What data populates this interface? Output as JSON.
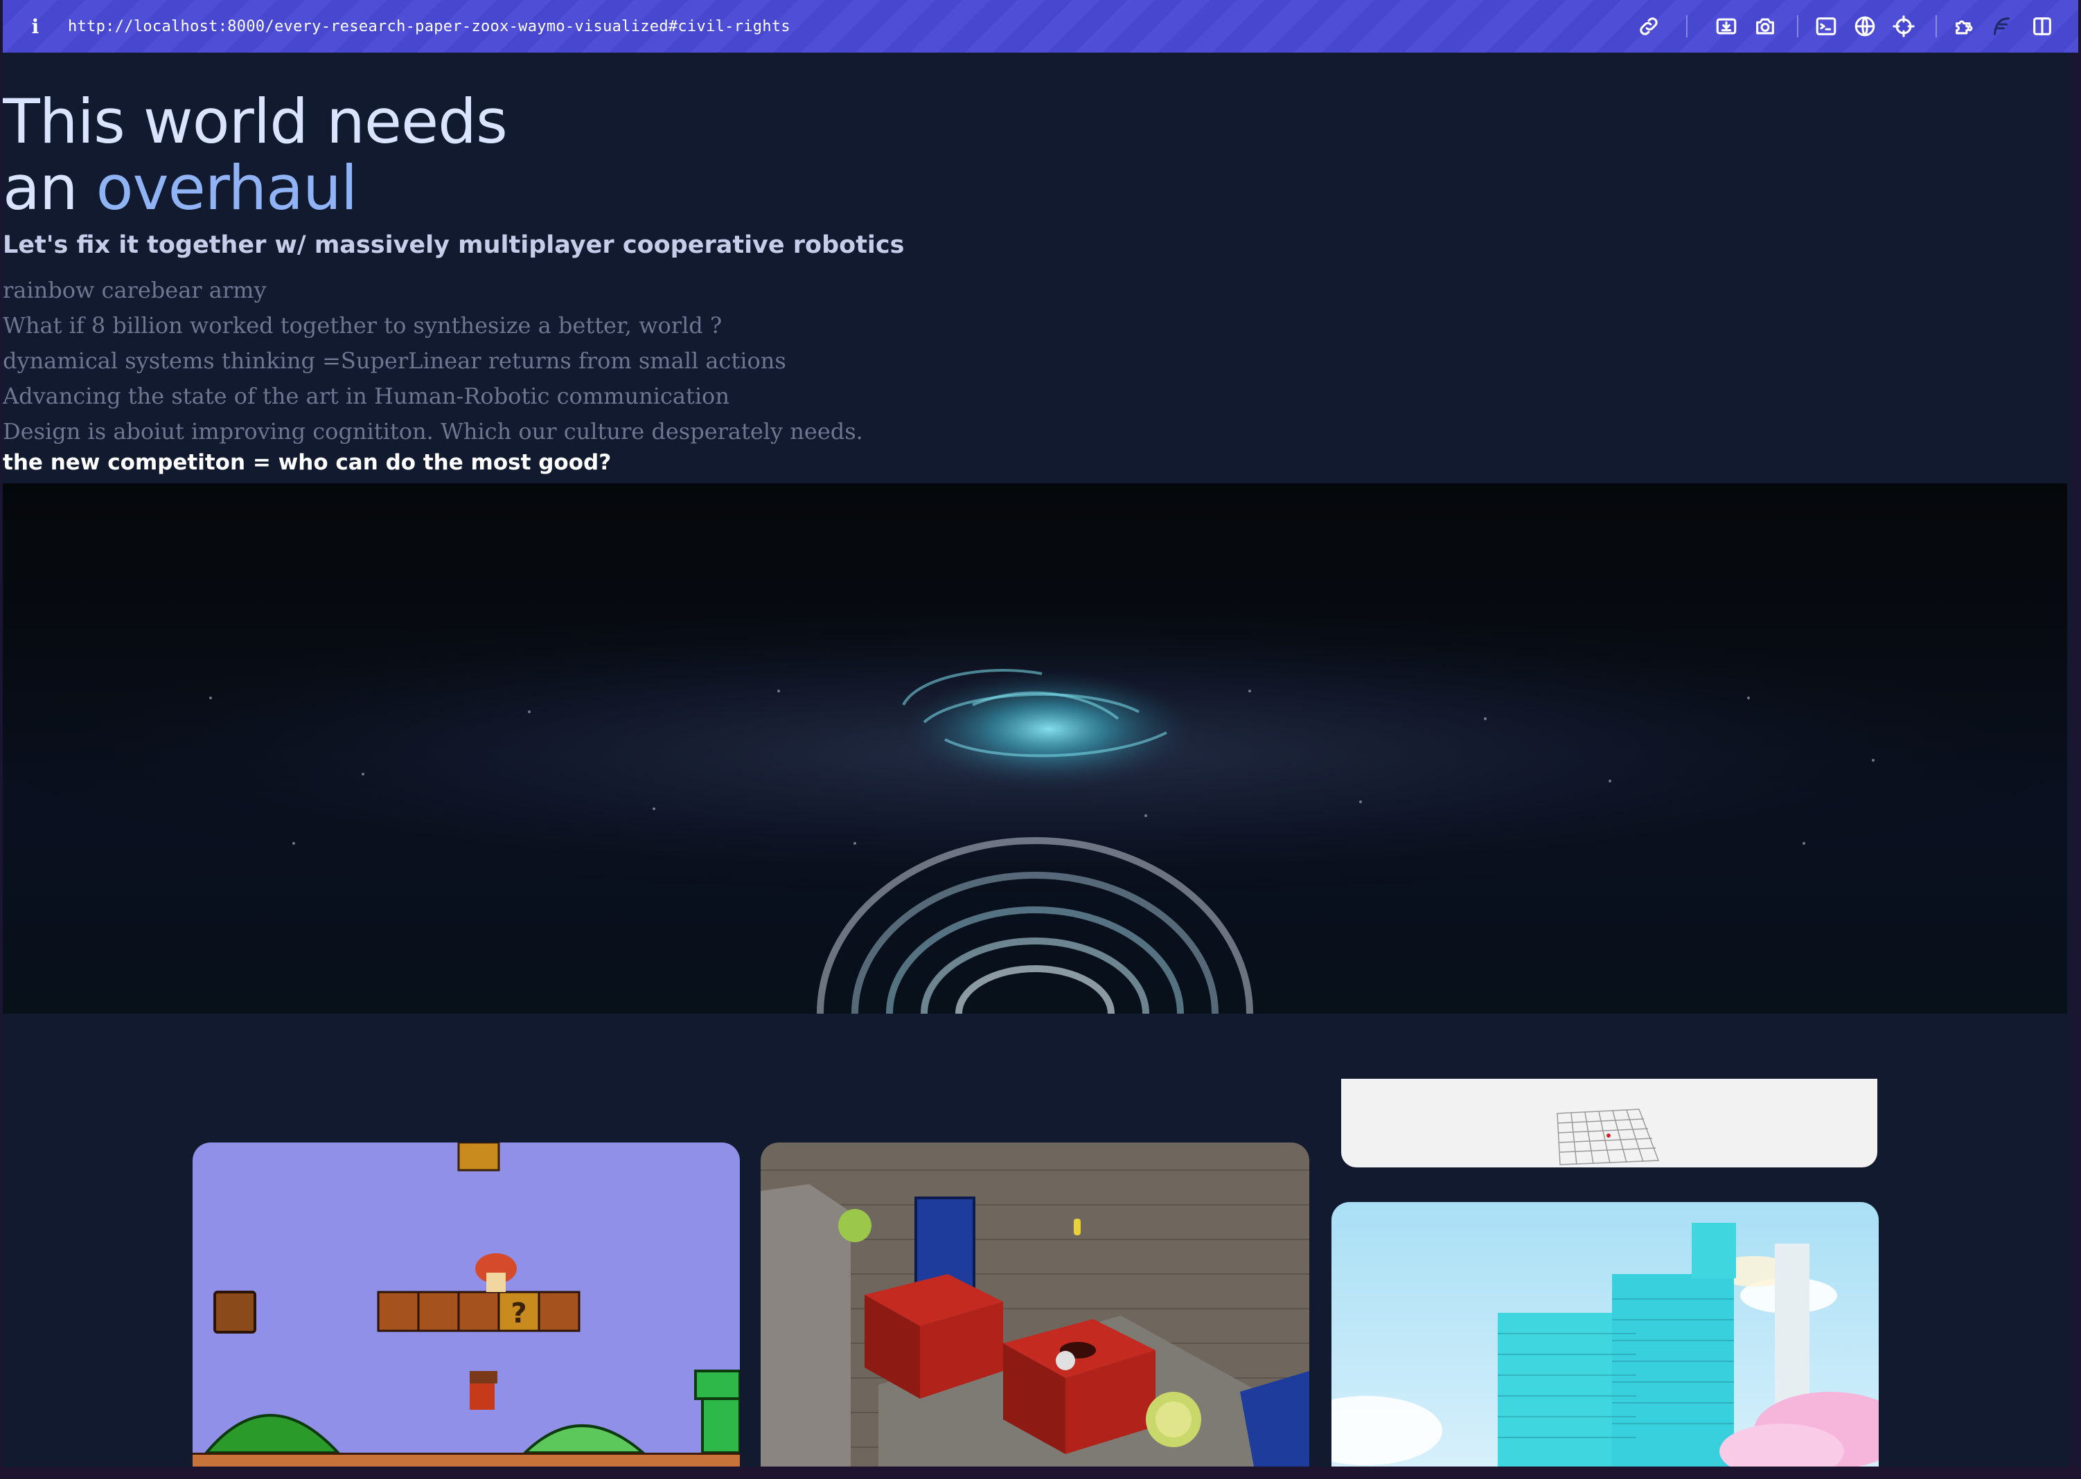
{
  "toolbar": {
    "url": "http://localhost:8000/every-research-paper-zoox-waymo-visualized#civil-rights",
    "info_icon": "i",
    "icons": [
      "link-icon",
      "download-icon",
      "camera-icon",
      "terminal-icon",
      "globe-icon",
      "crosshair-icon",
      "extensions-icon",
      "feather-icon",
      "sidebar-icon"
    ]
  },
  "hero": {
    "title_line1": "This world needs",
    "title_line2_prefix": "an ",
    "title_line2_highlight": "overhaul",
    "subtitle": "Let's fix it together w/ massively multiplayer cooperative robotics",
    "lines": [
      "rainbow carebear army",
      "What if 8 billion worked together to synthesize a better, world ?",
      "dynamical systems thinking =SuperLinear returns from small actions",
      "Advancing the state of the art in Human-Robotic communication",
      "Design is aboiut improving cognititon. Which our culture desperately needs."
    ],
    "tagline": "the new competiton = who can do the most good?"
  },
  "colors": {
    "toolbar": "#4a4ad2",
    "page_bg": "#121a2f",
    "title": "#dbe4ff",
    "title_highlight": "#8fb3f5",
    "body_text": "#6e7690"
  },
  "gallery": {
    "items": [
      "mario-game-card",
      "voxel-cube-game-card",
      "grid-plane-card",
      "city-skyline-card"
    ]
  }
}
